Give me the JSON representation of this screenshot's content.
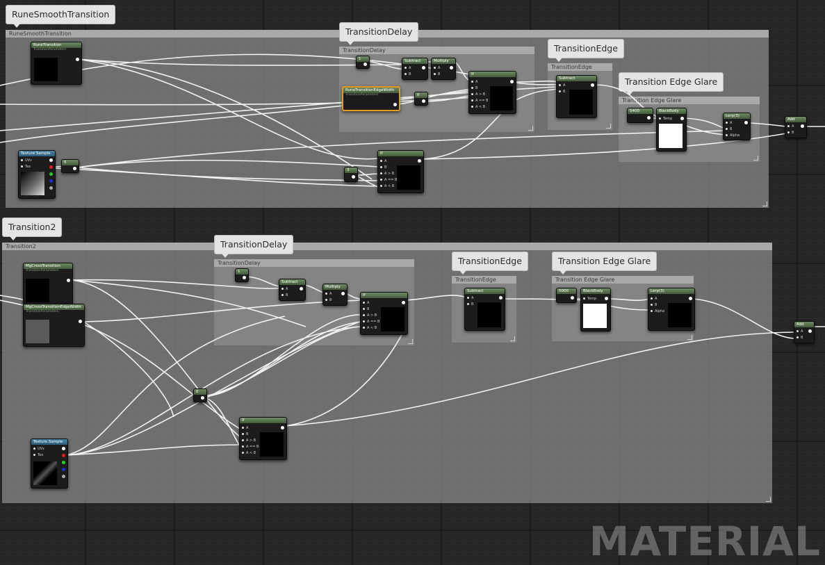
{
  "groups": {
    "top": {
      "bubble": "RuneSmoothTransition",
      "bar": "RuneSmoothTransition"
    },
    "bottom": {
      "bubble": "Transition2",
      "bar": "Transition2"
    },
    "top_delay": {
      "bubble": "TransitionDelay",
      "bar": "TransitionDelay"
    },
    "top_edge": {
      "bubble": "TransitionEdge",
      "bar": "TransitionEdge"
    },
    "top_glare": {
      "bubble": "Transition Edge Glare",
      "bar": "Transition Edge Glare"
    },
    "bot_delay": {
      "bubble": "TransitionDelay",
      "bar": "TransitionDelay"
    },
    "bot_edge": {
      "bubble": "TransitionEdge",
      "bar": "TransitionEdge"
    },
    "bot_glare": {
      "bubble": "Transition Edge Glare",
      "bar": "Transition Edge Glare"
    }
  },
  "nodes": {
    "rune_param": "RuneTransition",
    "rune_edge_param": "RuneTransitionEdgeWidth",
    "param_sub": "TransitionParameters",
    "tex_sample": "Texture Sample",
    "uvs": "UVs",
    "tex": "Tex",
    "subtract": "Subtract",
    "multiply": "Multiply",
    "if": "If",
    "a": "A",
    "b": "B",
    "a_gt_b": "A > B",
    "a_eq_b": "A == B",
    "a_lt_b": "A < B",
    "blackbody": "BlackBody",
    "temp": "Temp",
    "lerp": "Lerp(3)",
    "alpha": "Alpha",
    "add": "Add",
    "const_1": "1",
    "const_0": "0",
    "const_5": "5",
    "const_3": "3",
    "const_5000": "5000",
    "const_5400": "5400",
    "bot_param1": "MgCrossTransition",
    "bot_param2": "MgCrossTransitionEdgeWidth"
  },
  "watermark": "MATERIAL"
}
